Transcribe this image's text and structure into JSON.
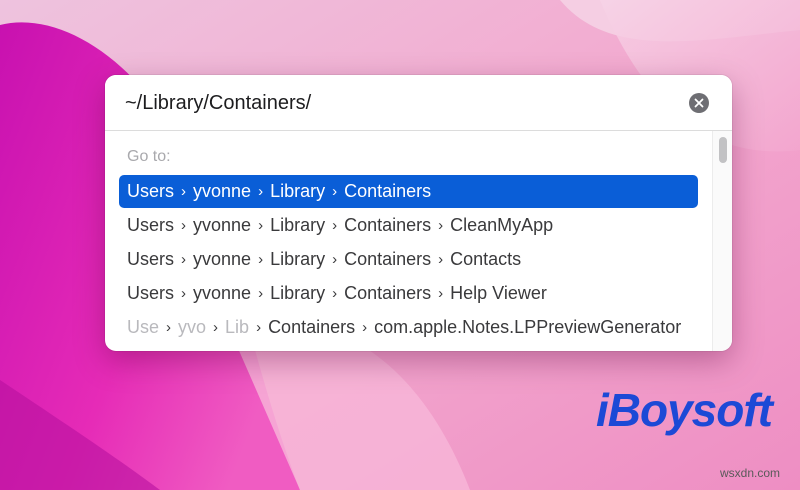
{
  "dialog": {
    "path_value": "~/Library/Containers/",
    "goto_label": "Go to:",
    "rows": [
      {
        "segments": [
          "Users",
          "yvonne",
          "Library",
          "Containers"
        ],
        "selected": true
      },
      {
        "segments": [
          "Users",
          "yvonne",
          "Library",
          "Containers",
          "CleanMyApp"
        ],
        "selected": false
      },
      {
        "segments": [
          "Users",
          "yvonne",
          "Library",
          "Containers",
          "Contacts"
        ],
        "selected": false
      },
      {
        "segments": [
          "Users",
          "yvonne",
          "Library",
          "Containers",
          "Help Viewer"
        ],
        "selected": false
      },
      {
        "segments": [
          "Users",
          "yvonne",
          "Library",
          "Containers",
          "com.apple.Notes.LPPreviewGenerator"
        ],
        "selected": false,
        "truncated_display": [
          "Use",
          "yvo",
          "Lib",
          "Containers",
          "com.apple.Notes.LPPreviewGenerator"
        ]
      }
    ],
    "separator_glyph": "›",
    "clear_icon": "clear-circle-icon"
  },
  "branding": {
    "logo_text": "iBoysoft",
    "watermark": "wsxdn.com"
  },
  "colors": {
    "selection": "#0a5ed7",
    "brand": "#1c49d6",
    "wallpaper_magenta": "#e020b4",
    "wallpaper_pink": "#f4b3d6"
  }
}
